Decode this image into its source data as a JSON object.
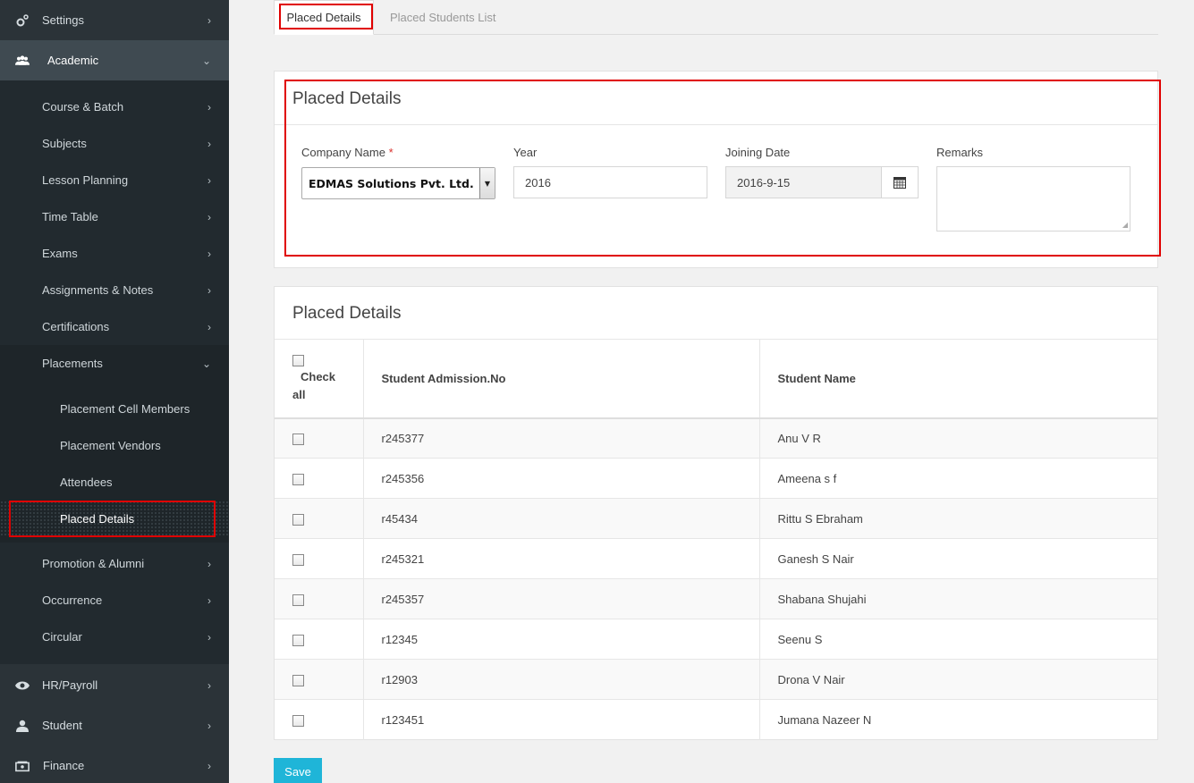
{
  "sidebar": {
    "settings": "Settings",
    "academic": "Academic",
    "academic_items": [
      "Course & Batch",
      "Subjects",
      "Lesson Planning",
      "Time Table",
      "Exams",
      "Assignments & Notes",
      "Certifications",
      "Placements"
    ],
    "placements_items": [
      "Placement Cell Members",
      "Placement Vendors",
      "Attendees",
      "Placed Details"
    ],
    "more_items": [
      "Promotion & Alumni",
      "Occurrence",
      "Circular"
    ],
    "hr_payroll": "HR/Payroll",
    "student": "Student",
    "finance": "Finance"
  },
  "tabs": [
    "Placed Details",
    "Placed Students List"
  ],
  "form_panel": {
    "title": "Placed Details",
    "company_label": "Company Name",
    "required_mark": "*",
    "company_value": "EDMAS Solutions Pvt. Ltd.",
    "year_label": "Year",
    "year_value": "2016",
    "joining_label": "Joining Date",
    "joining_value": "2016-9-15",
    "remarks_label": "Remarks"
  },
  "list_panel": {
    "title": "Placed Details",
    "col_check": "Check all",
    "col_admission": "Student Admission.No",
    "col_name": "Student Name",
    "rows": [
      {
        "admission": "r245377",
        "name": "Anu V R"
      },
      {
        "admission": "r245356",
        "name": "Ameena s f"
      },
      {
        "admission": "r45434",
        "name": "Rittu S Ebraham"
      },
      {
        "admission": "r245321",
        "name": "Ganesh S Nair"
      },
      {
        "admission": "r245357",
        "name": "Shabana Shujahi"
      },
      {
        "admission": "r12345",
        "name": "Seenu S"
      },
      {
        "admission": "r12903",
        "name": "Drona V Nair"
      },
      {
        "admission": "r123451",
        "name": "Jumana Nazeer N"
      }
    ]
  },
  "save_label": "Save"
}
